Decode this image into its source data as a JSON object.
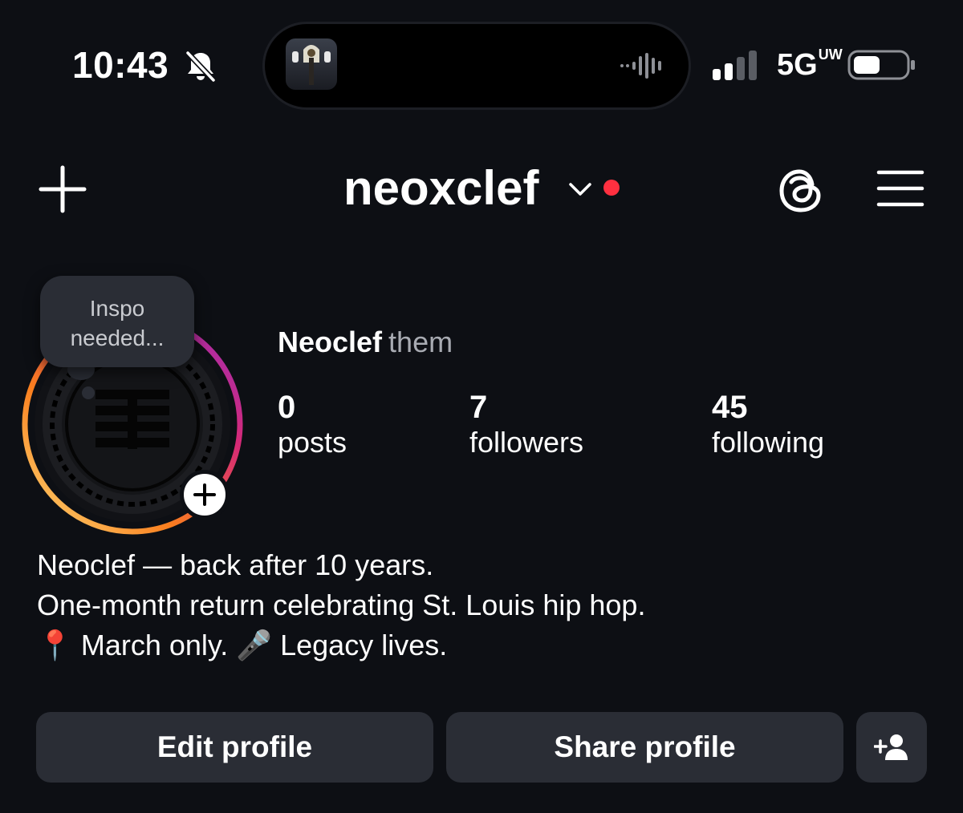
{
  "status_bar": {
    "time": "10:43",
    "network": "5G",
    "network_badge": "UW",
    "icons": [
      "bell-slash-icon",
      "audio-wave-icon",
      "signal-icon",
      "battery-icon"
    ]
  },
  "header": {
    "username": "neoxclef",
    "icons": [
      "plus-icon",
      "chevron-down-icon",
      "threads-icon",
      "menu-icon"
    ],
    "notification_dot_color": "#ff3040"
  },
  "profile": {
    "note": "Inspo needed...",
    "display_name": "Neoclef",
    "pronouns": "them",
    "stats": {
      "posts": {
        "value": "0",
        "label": "posts"
      },
      "followers": {
        "value": "7",
        "label": "followers"
      },
      "following": {
        "value": "45",
        "label": "following"
      }
    },
    "bio": {
      "line1": "Neoclef — back after 10 years.",
      "line2": "One-month return celebrating St. Louis hip hop.",
      "line3_emoji1": "📍",
      "line3_text1": "March only.",
      "line3_emoji2": "🎤",
      "line3_text2": "Legacy lives."
    }
  },
  "actions": {
    "edit_label": "Edit profile",
    "share_label": "Share profile",
    "discover_icon": "add-person-icon"
  },
  "colors": {
    "background": "#0d0f14",
    "button": "#2a2d35",
    "ring_gradient": [
      "#feda75",
      "#fa7e1e",
      "#d62976",
      "#962fbf"
    ]
  }
}
